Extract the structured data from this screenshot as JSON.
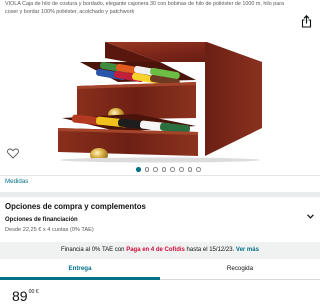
{
  "product": {
    "title": "VIOLA Caja de hilo de costura y bordado, elegante cajonera 30 con bobinas de hilo de poliéster de 1000 m, hilo para coser y bordar 100% poliéster, acolchado y patchwork",
    "image_alt": "Caja de hilo de costura de madera con dos cajones y bobinas de colores",
    "image_dots_count": 8,
    "image_dots_active_index": 0,
    "measures_link": "Medidas"
  },
  "purchase_section": {
    "title": "Opciones de compra y complementos",
    "financing": {
      "title": "Opciones de financiación",
      "subtitle": "Desde 22,25 € x 4 cuotas (0% TAE)"
    }
  },
  "promo": {
    "text_before": "Financia al 0% TAE con ",
    "accent": "Paga en 4 de Cofidis",
    "text_after": " hasta el 15/12/23. ",
    "link": "Ver más",
    "accent_color": "#cc0c39",
    "link_color": "#007185"
  },
  "tabs": [
    {
      "label": "Entrega",
      "active": true
    },
    {
      "label": "Recogida",
      "active": false
    }
  ],
  "price": {
    "whole": "89",
    "fraction": "00 €"
  },
  "colors": {
    "link": "#007185",
    "text": "#0f1111",
    "muted": "#565959",
    "wood": "#7a2418"
  }
}
